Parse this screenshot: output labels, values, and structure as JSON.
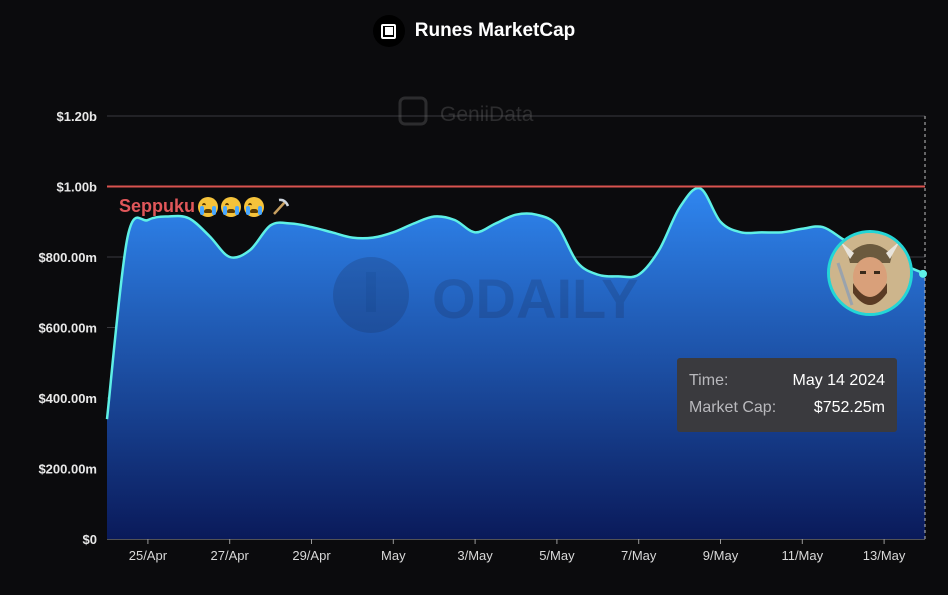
{
  "chart_data": {
    "type": "area",
    "title": "Runes MarketCap",
    "x": [
      "Apr 24",
      "Apr 24.5",
      "Apr 25",
      "Apr 25.5",
      "Apr 26",
      "Apr 26.5",
      "Apr 27",
      "Apr 27.5",
      "Apr 28",
      "Apr 28.5",
      "Apr 29",
      "Apr 29.5",
      "Apr 30",
      "Apr 30.5",
      "May 1",
      "May 1.5",
      "May 2",
      "May 2.5",
      "May 3",
      "May 3.5",
      "May 4",
      "May 4.5",
      "May 5",
      "May 5.5",
      "May 6",
      "May 6.5",
      "May 7",
      "May 7.5",
      "May 8",
      "May 8.5",
      "May 9",
      "May 9.5",
      "May 10",
      "May 10.5",
      "May 11",
      "May 11.5",
      "May 12",
      "May 12.5",
      "May 13",
      "May 13.5",
      "May 14"
    ],
    "values": [
      340,
      855,
      905,
      915,
      910,
      860,
      800,
      820,
      890,
      895,
      885,
      870,
      855,
      855,
      870,
      895,
      915,
      905,
      870,
      895,
      920,
      920,
      890,
      785,
      750,
      745,
      750,
      820,
      940,
      995,
      900,
      870,
      870,
      870,
      880,
      885,
      850,
      815,
      790,
      775,
      752.25
    ],
    "ylim": [
      0,
      1200
    ],
    "y_ticks": [
      "$0",
      "$200.00m",
      "$400.00m",
      "$600.00m",
      "$800.00m",
      "$1.00b",
      "$1.20b"
    ],
    "x_ticks": [
      {
        "label": "25/Apr",
        "x": "Apr 25"
      },
      {
        "label": "27/Apr",
        "x": "Apr 27"
      },
      {
        "label": "29/Apr",
        "x": "Apr 29"
      },
      {
        "label": "May",
        "x": "May 1"
      },
      {
        "label": "3/May",
        "x": "May 3"
      },
      {
        "label": "5/May",
        "x": "May 5"
      },
      {
        "label": "7/May",
        "x": "May 7"
      },
      {
        "label": "9/May",
        "x": "May 9"
      },
      {
        "label": "11/May",
        "x": "May 11"
      },
      {
        "label": "13/May",
        "x": "May 13"
      }
    ],
    "reference_line": {
      "value": 1000,
      "color": "#d9534f"
    },
    "annotation": "Seppuku",
    "grid": true,
    "colors": {
      "line": "#5ef0e6",
      "fill_top": "#2f86f0",
      "fill_bottom": "#0a1a5a"
    }
  },
  "watermarks": {
    "top": "GeniiData",
    "center": "ODAILY"
  },
  "tooltip": {
    "time_label": "Time:",
    "time_value": "May 14 2024",
    "cap_label": "Market Cap:",
    "cap_value": "$752.25m"
  }
}
